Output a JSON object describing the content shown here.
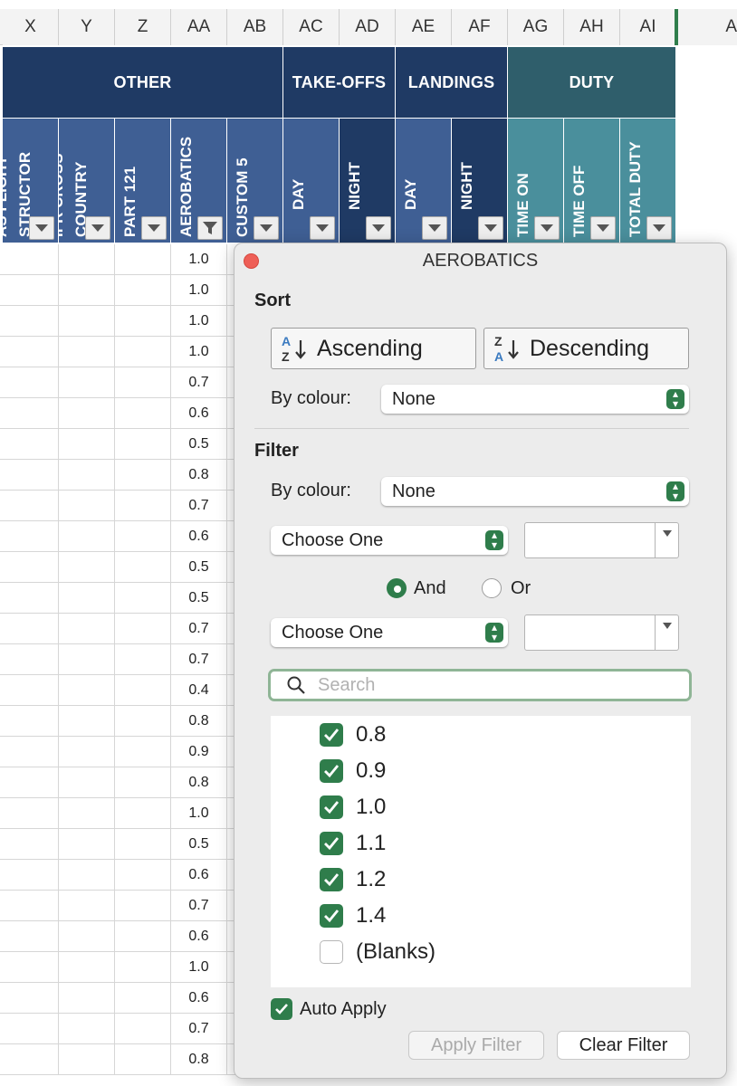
{
  "columns": [
    "X",
    "Y",
    "Z",
    "AA",
    "AB",
    "AC",
    "AD",
    "AE",
    "AF",
    "AG",
    "AH",
    "AI",
    "A"
  ],
  "groups": {
    "other": "OTHER",
    "takeoffs": "TAKE-OFFS",
    "landings": "LANDINGS",
    "duty": "DUTY"
  },
  "subheaders": [
    "AS FLIGHT",
    "STRUCTOR",
    "IFR CROSS",
    "COUNTRY",
    "PART 121",
    "AEROBATICS",
    "CUSTOM 5",
    "DAY",
    "NIGHT",
    "DAY",
    "NIGHT",
    "TIME ON",
    "TIME OFF",
    "TOTAL DUTY"
  ],
  "aerobatics_values": [
    "1.0",
    "1.0",
    "1.0",
    "1.0",
    "0.7",
    "0.6",
    "0.5",
    "0.8",
    "0.7",
    "0.6",
    "0.5",
    "0.5",
    "0.7",
    "0.7",
    "0.4",
    "0.8",
    "0.9",
    "0.8",
    "1.0",
    "0.5",
    "0.6",
    "0.7",
    "0.6",
    "1.0",
    "0.6",
    "0.7",
    "0.8"
  ],
  "popup": {
    "title": "AEROBATICS",
    "sort": {
      "title": "Sort",
      "ascending": "Ascending",
      "descending": "Descending",
      "by_colour_label": "By colour:",
      "by_colour_value": "None"
    },
    "filter": {
      "title": "Filter",
      "by_colour_label": "By colour:",
      "by_colour_value": "None",
      "condition1": "Choose One",
      "condition2": "Choose One",
      "and_label": "And",
      "or_label": "Or",
      "search_placeholder": "Search",
      "items": [
        {
          "label": "0.8",
          "checked": true
        },
        {
          "label": "0.9",
          "checked": true
        },
        {
          "label": "1.0",
          "checked": true
        },
        {
          "label": "1.1",
          "checked": true
        },
        {
          "label": "1.2",
          "checked": true
        },
        {
          "label": "1.4",
          "checked": true
        },
        {
          "label": "(Blanks)",
          "checked": false
        }
      ]
    },
    "auto_apply": "Auto Apply",
    "apply_filter": "Apply Filter",
    "clear_filter": "Clear Filter"
  },
  "colors": {
    "navy": "#1f3a64",
    "blue_mid": "#2f5597",
    "teal": "#2f6b73",
    "teal_light": "#4a8f9c",
    "accent_green": "#2f7d4b"
  }
}
